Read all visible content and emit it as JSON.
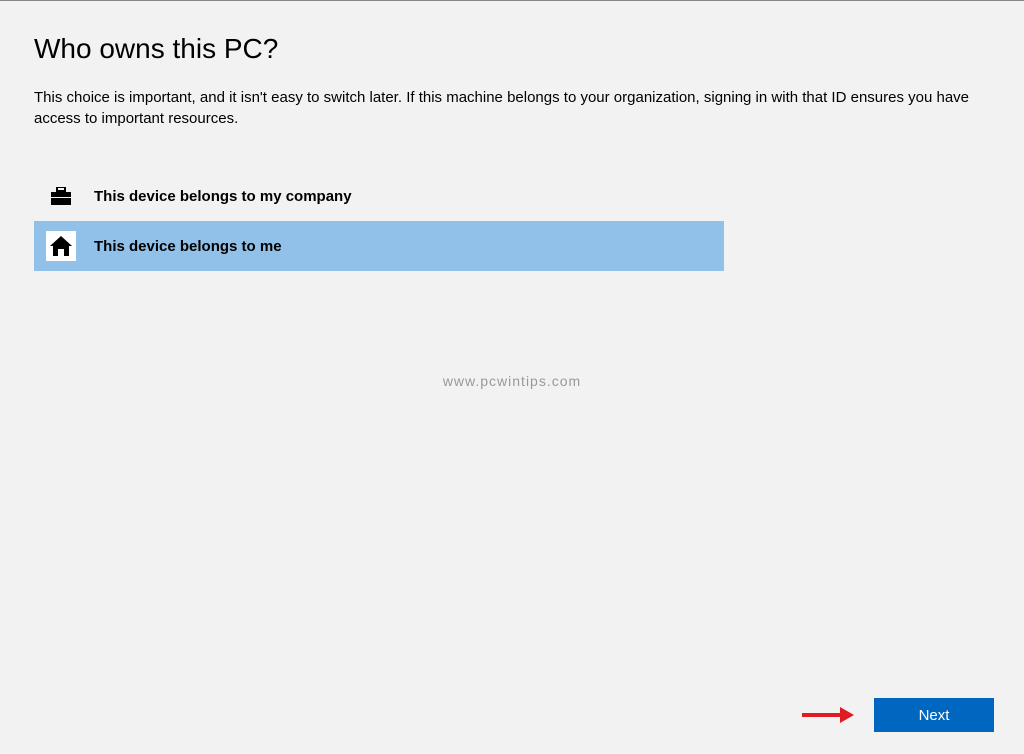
{
  "page": {
    "title": "Who owns this PC?",
    "description": "This choice is important, and it isn't easy to switch later. If this machine belongs to your organization, signing in with that ID ensures you have access to important resources."
  },
  "options": {
    "company": {
      "label": "This device belongs to my company",
      "icon": "briefcase-icon",
      "selected": false
    },
    "personal": {
      "label": "This device belongs to me",
      "icon": "home-icon",
      "selected": true
    }
  },
  "watermark": "www.pcwintips.com",
  "buttons": {
    "next": "Next"
  },
  "colors": {
    "selection": "#91c0e8",
    "primary_button": "#0067c0",
    "arrow": "#e01b24"
  }
}
